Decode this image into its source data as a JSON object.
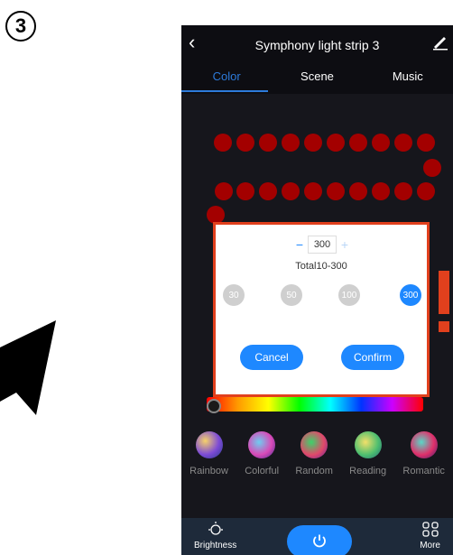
{
  "step_number": "3",
  "header": {
    "title": "Symphony light strip 3"
  },
  "tabs": [
    {
      "label": "Color",
      "active": true
    },
    {
      "label": "Scene",
      "active": false
    },
    {
      "label": "Music",
      "active": false
    }
  ],
  "colors": {
    "accent": "#2d7bdb",
    "led": "#a30000",
    "highlight_border": "#e1401d",
    "button": "#1e88ff"
  },
  "dialog": {
    "count_value": "300",
    "decrement_label": "−",
    "increment_label": "+",
    "range_text": "Total10-300",
    "presets": [
      "30",
      "50",
      "100",
      "300"
    ],
    "selected_preset": "300",
    "cancel_label": "Cancel",
    "confirm_label": "Confirm"
  },
  "modes": [
    {
      "label": "Rainbow"
    },
    {
      "label": "Colorful"
    },
    {
      "label": "Random"
    },
    {
      "label": "Reading"
    },
    {
      "label": "Romantic"
    }
  ],
  "bottom_bar": {
    "brightness_label": "Brightness",
    "more_label": "More"
  }
}
